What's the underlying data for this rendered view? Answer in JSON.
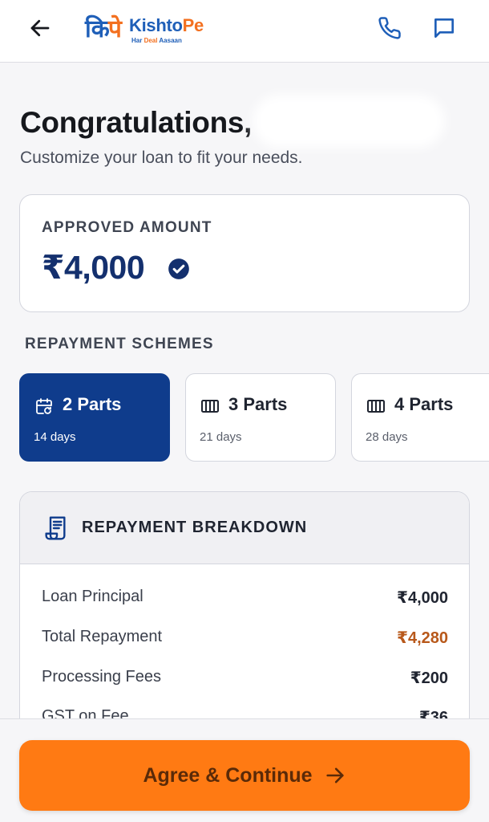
{
  "header": {
    "logo_mark": "कि",
    "logo_mark_accent": "पे",
    "brand_name_part1": "Kishto",
    "brand_name_part2": "Pe",
    "tagline_part1": "Har ",
    "tagline_part2": "Deal",
    "tagline_part3": " Aasaan",
    "icons": {
      "back": "arrow-left-icon",
      "call": "phone-icon",
      "chat": "chat-icon"
    }
  },
  "greeting": {
    "title": "Congratulations,",
    "subtitle": "Customize your loan to fit your needs."
  },
  "approved": {
    "label": "APPROVED AMOUNT",
    "amount": "₹4,000",
    "verified_icon": "verified-check-icon"
  },
  "schemes": {
    "title": "REPAYMENT SCHEMES",
    "selected": "2 Parts",
    "items": [
      {
        "title": "2 Parts",
        "days": "14 days",
        "icon": "calendar-refresh-icon"
      },
      {
        "title": "3 Parts",
        "days": "21 days",
        "icon": "segments-icon"
      },
      {
        "title": "4 Parts",
        "days": "28 days",
        "icon": "segments-icon"
      }
    ]
  },
  "breakdown": {
    "title": "REPAYMENT BREAKDOWN",
    "icon": "receipt-icon",
    "rows": [
      {
        "label": "Loan Principal",
        "value": "₹4,000"
      },
      {
        "label": "Total Repayment",
        "value": "₹4,280"
      },
      {
        "label": "Processing Fees",
        "value": "₹200"
      },
      {
        "label": "GST on Fee",
        "value": "₹36"
      }
    ]
  },
  "cta": {
    "label": "Agree & Continue",
    "icon": "arrow-right-icon"
  },
  "colors": {
    "primary_blue": "#0f3c8c",
    "accent_orange": "#ff7a13",
    "total_repayment": "#b8581a"
  }
}
